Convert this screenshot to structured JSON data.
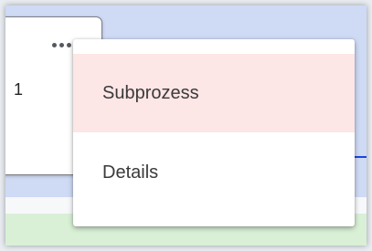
{
  "card": {
    "number": "1",
    "more_icon": "more-horizontal-icon"
  },
  "menu": {
    "items": [
      {
        "label": "Subprozess",
        "highlighted": true
      },
      {
        "label": "Details",
        "highlighted": false
      }
    ],
    "highlight_color": "#fde6e6"
  },
  "colors": {
    "canvas": "#cfdaf4",
    "lane_green": "#d9f0d6",
    "accent_line": "#1846e0"
  }
}
